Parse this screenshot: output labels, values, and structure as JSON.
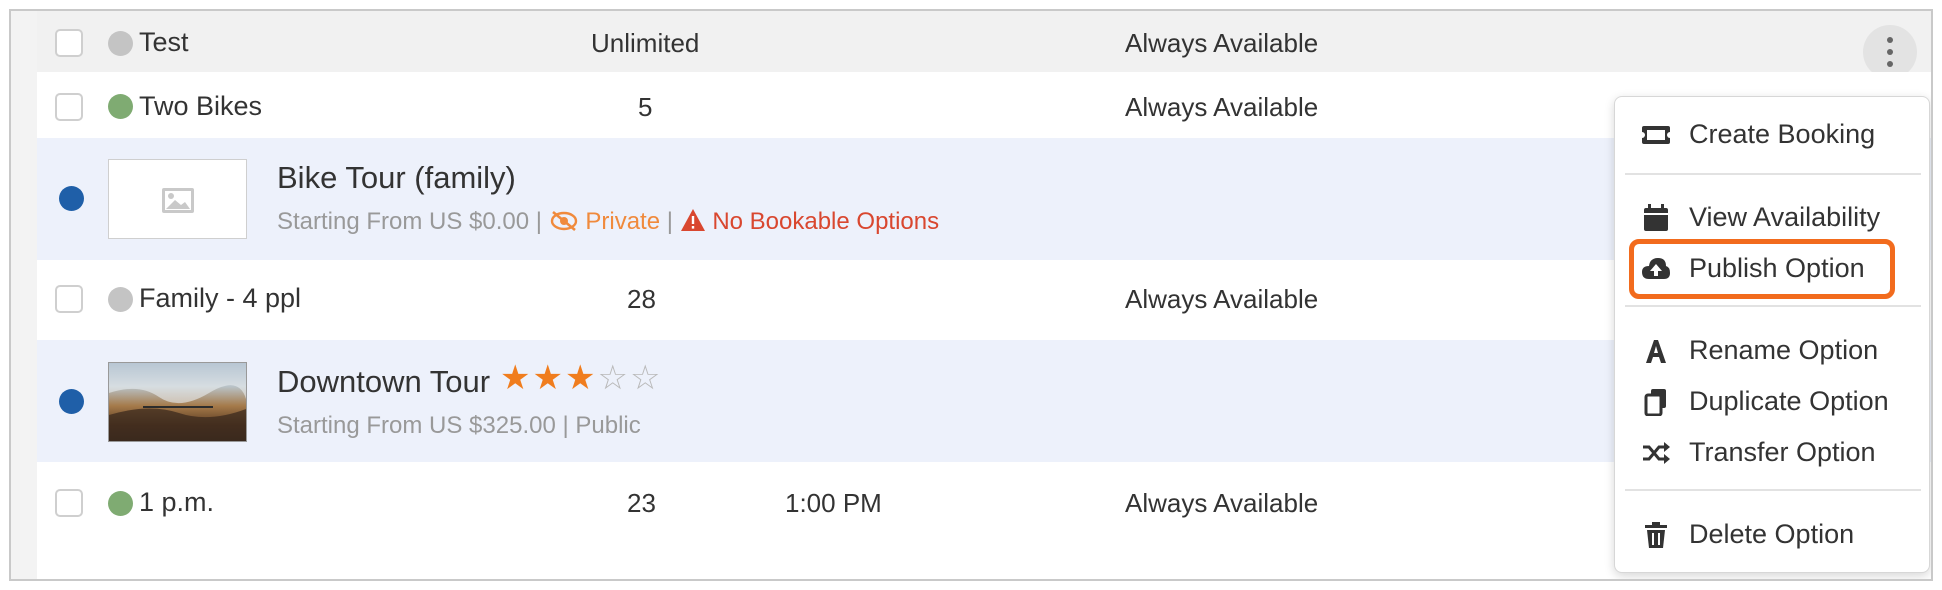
{
  "rows": [
    {
      "name": "Test",
      "quantity": "Unlimited",
      "time": "",
      "availability": "Always Available",
      "status_color": "#c4c4c4"
    },
    {
      "name": "Two Bikes",
      "quantity": "5",
      "time": "",
      "availability": "Always Available",
      "status_color": "#7fab72"
    },
    {
      "name": "Family - 4 ppl",
      "quantity": "28",
      "time": "",
      "availability": "Always Available",
      "status_color": "#c4c4c4"
    },
    {
      "name": "1 p.m.",
      "quantity": "23",
      "time": "1:00 PM",
      "availability": "Always Available",
      "status_color": "#7fab72"
    }
  ],
  "tours": [
    {
      "title": "Bike Tour (family)",
      "starting_from": "Starting From US $0.00",
      "separator": "|",
      "visibility": "Private",
      "warning": "No Bookable Options",
      "dot_color": "#1f5fa8",
      "thumbnail": "image-placeholder-icon"
    },
    {
      "title": "Downtown Tour",
      "starting_from": "Starting From US $325.00",
      "separator": "|",
      "visibility": "Public",
      "rating": 3,
      "rating_max": 5,
      "dot_color": "#1f5fa8",
      "thumbnail": "tour-photo"
    }
  ],
  "menu": {
    "items": [
      {
        "label": "Create Booking",
        "icon": "ticket-icon"
      },
      {
        "label": "View Availability",
        "icon": "calendar-icon"
      },
      {
        "label": "Publish Option",
        "icon": "cloud-upload-icon",
        "highlighted": true
      },
      {
        "label": "Rename Option",
        "icon": "letter-a-icon"
      },
      {
        "label": "Duplicate Option",
        "icon": "copy-icon"
      },
      {
        "label": "Transfer Option",
        "icon": "shuffle-icon"
      },
      {
        "label": "Delete Option",
        "icon": "trash-icon"
      }
    ]
  },
  "colors": {
    "accent_orange": "#f26b1d",
    "warning_red": "#d9472f",
    "private_orange": "#f08a3c",
    "star_orange": "#f07d1e"
  }
}
